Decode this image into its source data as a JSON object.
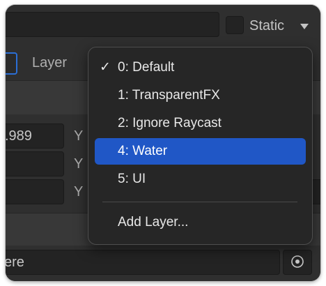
{
  "toolbar": {
    "static_label": "Static",
    "static_checked": false
  },
  "layer_row": {
    "label": "Layer"
  },
  "transform": {
    "x_value_partial": ".989",
    "y_label": "Y"
  },
  "bottom_field": {
    "value_partial": "ere"
  },
  "layer_menu": {
    "items": [
      {
        "label": "0: Default",
        "checked": true,
        "highlighted": false
      },
      {
        "label": "1: TransparentFX",
        "checked": false,
        "highlighted": false
      },
      {
        "label": "2: Ignore Raycast",
        "checked": false,
        "highlighted": false
      },
      {
        "label": "4: Water",
        "checked": false,
        "highlighted": true
      },
      {
        "label": "5: UI",
        "checked": false,
        "highlighted": false
      }
    ],
    "add_layer_label": "Add Layer..."
  },
  "colors": {
    "panel_bg": "#2f2f2f",
    "menu_bg": "#262626",
    "highlight": "#2057c6",
    "text": "#bdbdbd"
  }
}
